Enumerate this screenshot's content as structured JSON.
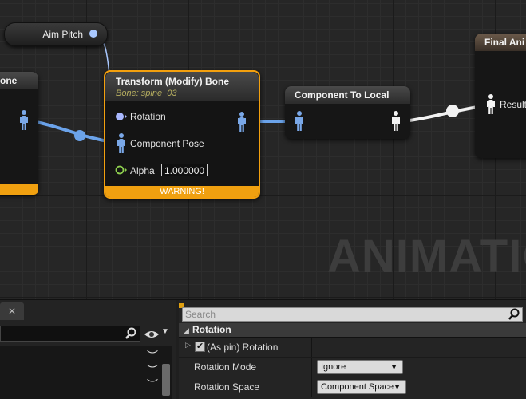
{
  "graph": {
    "aim_pitch_label": "Aim Pitch",
    "left_node_title": "one",
    "transform_node": {
      "title": "Transform (Modify) Bone",
      "subtitle": "Bone: spine_03",
      "pin_rotation": "Rotation",
      "pin_component_pose": "Component Pose",
      "pin_alpha": "Alpha",
      "alpha_value": "1.000000",
      "warning": "WARNING!"
    },
    "component_to_local_title": "Component To Local",
    "final_node": {
      "title": "Final Ani",
      "pin_result": "Result"
    },
    "watermark": "ANIMATIO",
    "colors": {
      "warning": "#f0a010",
      "pose_pin": "#7aa8e8",
      "float_pin": "#8fd14f"
    }
  },
  "left_panel": {
    "tab_close": "✕",
    "search_placeholder": "",
    "view_options": "eye-icon"
  },
  "details": {
    "search_placeholder": "Search",
    "category": "Rotation",
    "as_pin_label": "(As pin) Rotation",
    "as_pin_checked": true,
    "rows": [
      {
        "label": "Rotation Mode",
        "value": "Ignore"
      },
      {
        "label": "Rotation Space",
        "value": "Component Space"
      }
    ]
  }
}
